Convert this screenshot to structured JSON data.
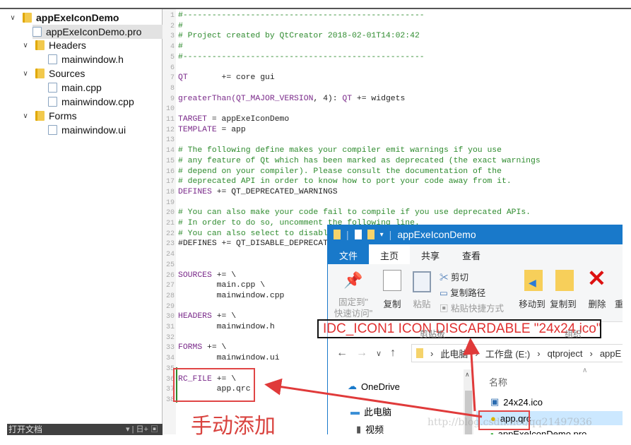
{
  "sidebar": {
    "project": "appExeIconDemo",
    "items": [
      {
        "label": "appExeIconDemo.pro"
      },
      {
        "label": "Headers"
      },
      {
        "label": "mainwindow.h"
      },
      {
        "label": "Sources"
      },
      {
        "label": "main.cpp"
      },
      {
        "label": "mainwindow.cpp"
      },
      {
        "label": "Forms"
      },
      {
        "label": "mainwindow.ui"
      }
    ],
    "open_docs": "打开文档",
    "open_docs_tools": "▾ | 日+ ▣"
  },
  "editor": {
    "lines": [
      [
        [
          "#--------------------------------------------------",
          "cm"
        ]
      ],
      [
        [
          "#",
          "cm"
        ]
      ],
      [
        [
          "# Project created by QtCreator 2018-02-01T14:02:42",
          "cm"
        ]
      ],
      [
        [
          "#",
          "cm"
        ]
      ],
      [
        [
          "#--------------------------------------------------",
          "cm"
        ]
      ],
      [],
      [
        [
          "QT",
          "kw"
        ],
        [
          "       += core gui",
          "tx"
        ]
      ],
      [],
      [
        [
          "greaterThan(",
          "kw"
        ],
        [
          "QT_MAJOR_VERSION",
          "kw"
        ],
        [
          ", 4): ",
          "tx"
        ],
        [
          "QT",
          "kw"
        ],
        [
          " += widgets",
          "tx"
        ]
      ],
      [],
      [
        [
          "TARGET",
          "kw"
        ],
        [
          " = appExeIconDemo",
          "tx"
        ]
      ],
      [
        [
          "TEMPLATE",
          "kw"
        ],
        [
          " = app",
          "tx"
        ]
      ],
      [],
      [
        [
          "# The following define makes your compiler emit warnings if you use",
          "cm"
        ]
      ],
      [
        [
          "# any feature of Qt which has been marked as deprecated (the exact warnings",
          "cm"
        ]
      ],
      [
        [
          "# depend on your compiler). Please consult the documentation of the",
          "cm"
        ]
      ],
      [
        [
          "# deprecated API in order to know how to port your code away from it.",
          "cm"
        ]
      ],
      [
        [
          "DEFINES",
          "kw"
        ],
        [
          " += QT_DEPRECATED_WARNINGS",
          "tx"
        ]
      ],
      [],
      [
        [
          "# You can also make your code fail to compile if you use deprecated APIs.",
          "cm"
        ]
      ],
      [
        [
          "# In order to do so, uncomment the following line.",
          "cm"
        ]
      ],
      [
        [
          "# You can also select to disable deprecated APIs only up to a certain version of Qt.",
          "cm"
        ]
      ],
      [
        [
          "#DEFINES += QT_DISABLE_DEPRECATED_BEFORE=0x060000",
          "tx"
        ]
      ],
      [],
      [],
      [
        [
          "SOURCES",
          "kw"
        ],
        [
          " += \\",
          "tx"
        ]
      ],
      [
        [
          "        main.cpp \\",
          "tx"
        ]
      ],
      [
        [
          "        mainwindow.cpp",
          "tx"
        ]
      ],
      [],
      [
        [
          "HEADERS",
          "kw"
        ],
        [
          " += \\",
          "tx"
        ]
      ],
      [
        [
          "        mainwindow.h",
          "tx"
        ]
      ],
      [],
      [
        [
          "FORMS",
          "kw"
        ],
        [
          " += \\",
          "tx"
        ]
      ],
      [
        [
          "        mainwindow.ui",
          "tx"
        ]
      ],
      [],
      [
        [
          "RC_FILE",
          "kw"
        ],
        [
          " += \\",
          "tx"
        ]
      ],
      [
        [
          "        app.qrc",
          "tx"
        ]
      ],
      []
    ]
  },
  "annotation": {
    "note": "手动添加",
    "rc_line": "IDC_ICON1 ICON DISCARDABLE \"24x24.ico\""
  },
  "explorer": {
    "title": "appExeIconDemo",
    "tabs": [
      "文件",
      "主页",
      "共享",
      "查看"
    ],
    "ribbon": {
      "pin": "固定到\"\n快速访问\"",
      "copy": "复制",
      "paste": "粘贴",
      "cut": "剪切",
      "copy_path": "复制路径",
      "paste_shortcut": "粘贴快捷方式",
      "move_to": "移动到",
      "copy_to": "复制到",
      "delete": "删除",
      "rename": "重",
      "group_clipboard": "剪贴板",
      "group_organize": "组织"
    },
    "path": [
      "此电脑",
      "工作盘 (E:)",
      "qtproject",
      "appE"
    ],
    "nav": [
      "OneDrive",
      "此电脑",
      "视频"
    ],
    "column_name": "名称",
    "files": [
      "24x24.ico",
      "app.qrc",
      "appExeIconDemo.pro"
    ]
  },
  "watermark": "http://blog.csdn.net/qq21497936",
  "colors": {
    "accent": "#1979ca",
    "annotation": "#e04545",
    "comment": "#2e8b2e",
    "keyword": "#7a2a8a"
  }
}
